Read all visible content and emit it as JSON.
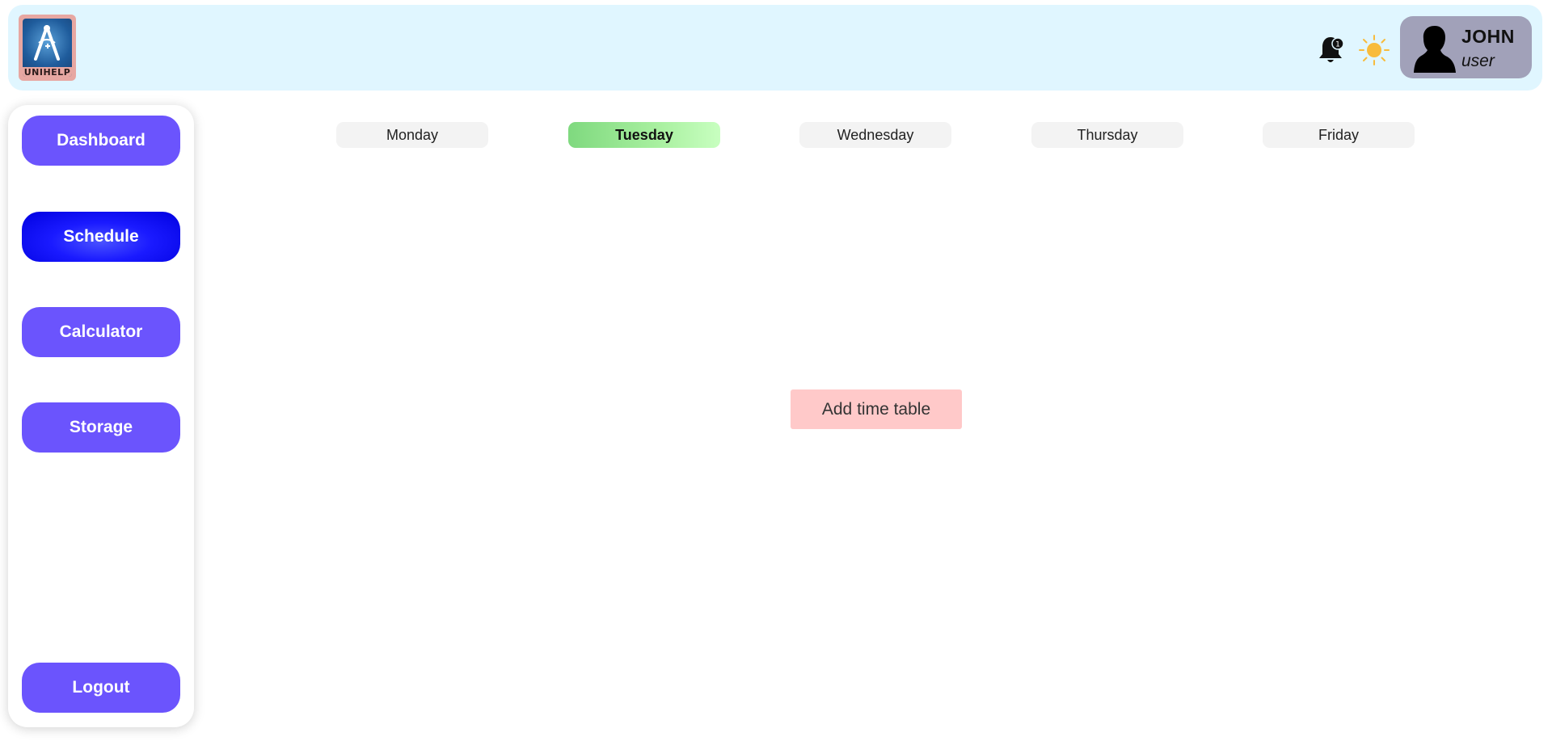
{
  "header": {
    "logo_text": "UNIHELP",
    "notification_count": "1",
    "icons": {
      "notification": "bell-icon",
      "theme": "sun-icon",
      "avatar": "user-silhouette-icon"
    },
    "user": {
      "name": "JOHN",
      "role": "user"
    }
  },
  "sidebar": {
    "items": [
      {
        "label": "Dashboard",
        "active": false
      },
      {
        "label": "Schedule",
        "active": true
      },
      {
        "label": "Calculator",
        "active": false
      },
      {
        "label": "Storage",
        "active": false
      }
    ],
    "logout_label": "Logout"
  },
  "schedule": {
    "days": [
      {
        "label": "Monday",
        "active": false
      },
      {
        "label": "Tuesday",
        "active": true
      },
      {
        "label": "Wednesday",
        "active": false
      },
      {
        "label": "Thursday",
        "active": false
      },
      {
        "label": "Friday",
        "active": false
      }
    ],
    "add_button_label": "Add time table"
  },
  "colors": {
    "header_bg": "#e0f6ff",
    "nav_button": "#6b54fd",
    "nav_active": "#1a1aff",
    "active_day": "#a9f0a0",
    "add_button": "#ffc9c9",
    "user_card": "#a1a1b9"
  }
}
